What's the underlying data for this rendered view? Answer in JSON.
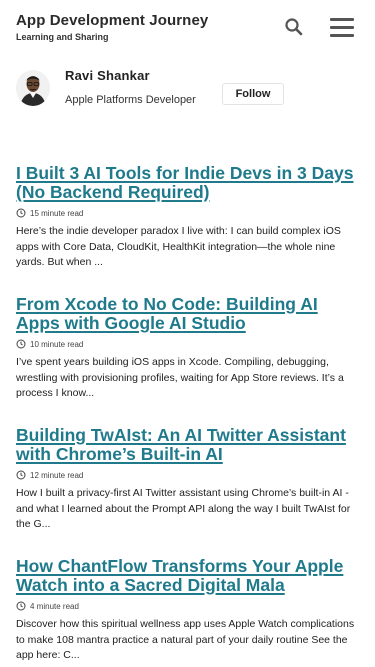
{
  "site": {
    "title": "App Development Journey",
    "tagline": "Learning and Sharing"
  },
  "header": {
    "search_icon": "search-icon",
    "menu_icon": "hamburger-menu-icon"
  },
  "author": {
    "name": "Ravi Shankar",
    "role": "Apple Platforms Developer",
    "follow_label": "Follow"
  },
  "accent_color": "#1f7a8c",
  "posts": [
    {
      "title": "I Built 3 AI Tools for Indie Devs in 3 Days (No Backend Required)",
      "read_time": "15 minute read",
      "excerpt": "Here’s the indie developer paradox I live with: I can build complex iOS apps with Core Data, CloudKit, HealthKit integration—the whole nine yards. But when ..."
    },
    {
      "title": "From Xcode to No Code: Building AI Apps with Google AI Studio",
      "read_time": "10 minute read",
      "excerpt": "I’ve spent years building iOS apps in Xcode. Compiling, debugging, wrestling with provisioning profiles, waiting for App Store reviews. It’s a process I know..."
    },
    {
      "title": "Building TwAIst: An AI Twitter Assistant with Chrome’s Built-in AI",
      "read_time": "12 minute read",
      "excerpt": "How I built a privacy-first AI Twitter assistant using Chrome’s built-in AI - and what I learned about the Prompt API along the way I built TwAIst for the G..."
    },
    {
      "title": "How ChantFlow Transforms Your Apple Watch into a Sacred Digital Mala",
      "read_time": "4 minute read",
      "excerpt": "Discover how this spiritual wellness app uses Apple Watch complications to make 108 mantra practice a natural part of your daily routine See the app here: C..."
    }
  ]
}
